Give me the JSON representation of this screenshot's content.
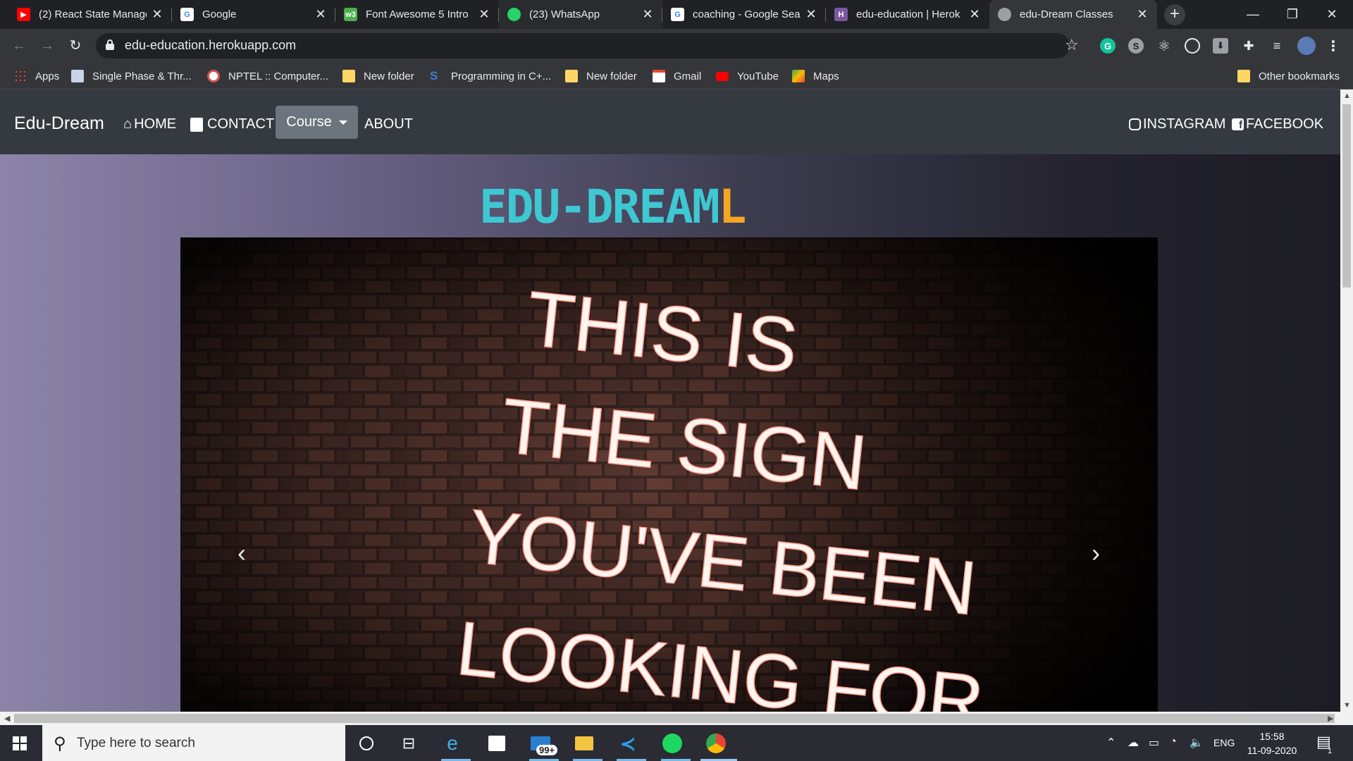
{
  "browser": {
    "tabs": [
      {
        "title": "(2) React State Manage",
        "icon": "youtube-icon",
        "color": "#ff0000"
      },
      {
        "title": "Google",
        "icon": "google-icon",
        "color": "#4285f4"
      },
      {
        "title": "Font Awesome 5 Intro",
        "icon": "w3schools-icon",
        "color": "#4caf50"
      },
      {
        "title": "(23) WhatsApp",
        "icon": "whatsapp-icon",
        "color": "#25d366",
        "badge": "23"
      },
      {
        "title": "coaching - Google Sea",
        "icon": "google-icon",
        "color": "#4285f4"
      },
      {
        "title": "edu-education | Herok",
        "icon": "heroku-icon",
        "color": "#79589f"
      },
      {
        "title": "edu-Dream Classes",
        "icon": "globe-icon",
        "color": "#9aa0a6"
      }
    ],
    "url": "edu-education.herokuapp.com",
    "bookmarks": [
      {
        "label": "Apps",
        "icon": "apps-grid-icon"
      },
      {
        "label": "Single Phase & Thr...",
        "icon": "page-icon"
      },
      {
        "label": "NPTEL :: Computer...",
        "icon": "nptel-icon"
      },
      {
        "label": "New folder",
        "icon": "folder-icon"
      },
      {
        "label": "Programming in C+...",
        "icon": "s-logo-icon"
      },
      {
        "label": "New folder",
        "icon": "folder-icon"
      },
      {
        "label": "Gmail",
        "icon": "gmail-icon"
      },
      {
        "label": "YouTube",
        "icon": "youtube-icon"
      },
      {
        "label": "Maps",
        "icon": "maps-icon"
      }
    ],
    "other_bookmarks": "Other bookmarks"
  },
  "site": {
    "brand": "Edu-Dream",
    "nav": {
      "home": "HOME",
      "contact": "CONTACT",
      "course": "Course",
      "about": "ABOUT",
      "instagram": "INSTAGRAM",
      "facebook": "FACEBOOK"
    },
    "logo_main": "EDU-DREAM",
    "logo_tail": "L",
    "carousel": {
      "sign_lines": [
        "THIS IS",
        "THE SIGN",
        "YOU'VE BEEN",
        "LOOKING FOR"
      ]
    }
  },
  "taskbar": {
    "search_placeholder": "Type here to search",
    "mail_badge": "99+",
    "language": "ENG",
    "time": "15:58",
    "date": "11-09-2020",
    "notification_count": "1"
  },
  "colors": {
    "navbar": "#343a40",
    "course_button": "#6c757d",
    "logo_teal": "#3ec8d2",
    "logo_orange": "#f6a623"
  }
}
